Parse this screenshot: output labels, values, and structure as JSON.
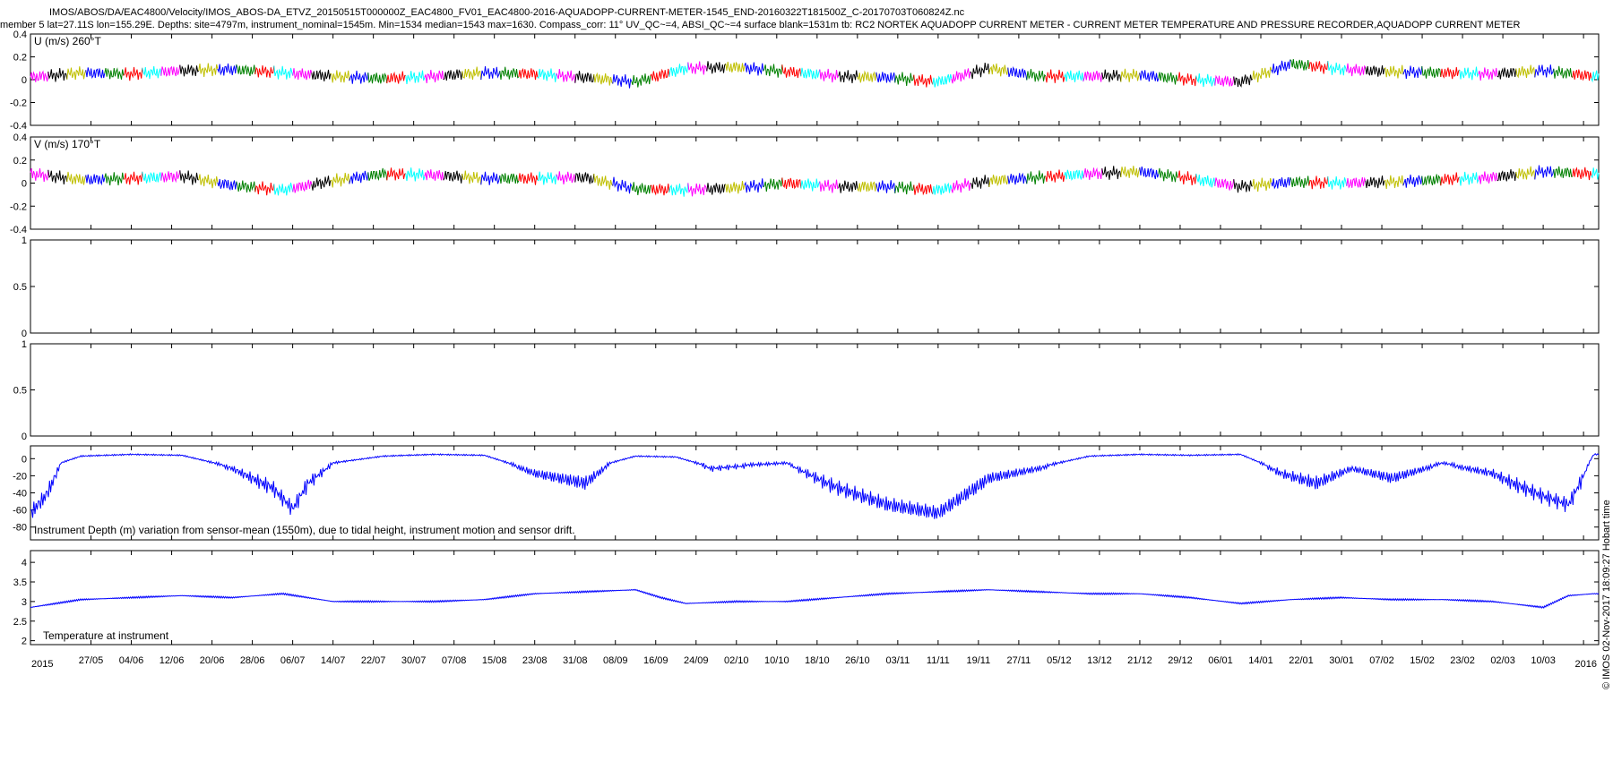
{
  "header": {
    "line1": "IMOS/ABOS/DA/EAC4800/Velocity/IMOS_ABOS-DA_ETVZ_20150515T000000Z_EAC4800_FV01_EAC4800-2016-AQUADOPP-CURRENT-METER-1545_END-20160322T181500Z_C-20170703T060824Z.nc",
    "line2": "member 5 lat=27.11S lon=155.29E. Depths: site=4797m, instrument_nominal=1545m. Min=1534 median=1543 max=1630. Compass_corr: 11° UV_QC~=4, ABSI_QC~=4 surface blank=1531m tb: RC2 NORTEK AQUADOPP CURRENT METER - CURRENT METER TEMPERATURE AND PRESSURE RECORDER,AQUADOPP CURRENT METER"
  },
  "watermark": "© IMOS 02-Nov-2017 18:09:27 Hobart time",
  "chart_data": [
    {
      "type": "line",
      "id": "u",
      "title": "U (m/s) 260°T",
      "ylim": [
        -0.4,
        0.4
      ],
      "yticks": [
        "0.4",
        "0.2",
        "0",
        "-0.2",
        "-0.4"
      ],
      "ytick_values": [
        0.4,
        0.2,
        0,
        -0.2,
        -0.4
      ],
      "series": [
        {
          "color": "multicolor",
          "x_days": [
            0,
            10,
            20,
            30,
            40,
            50,
            60,
            70,
            80,
            90,
            100,
            110,
            120,
            130,
            140,
            150,
            160,
            170,
            180,
            190,
            200,
            210,
            220,
            230,
            240,
            250,
            260,
            270,
            280,
            290,
            300,
            310
          ],
          "y_mean": [
            0.02,
            0.06,
            0.05,
            0.08,
            0.09,
            0.06,
            0.03,
            0.01,
            0.03,
            0.06,
            0.05,
            0.02,
            -0.02,
            0.1,
            0.11,
            0.07,
            0.03,
            0.02,
            -0.02,
            0.1,
            0.03,
            0.03,
            0.04,
            0.0,
            -0.02,
            0.14,
            0.09,
            0.07,
            0.06,
            0.05,
            0.08,
            0.03
          ]
        }
      ]
    },
    {
      "type": "line",
      "id": "v",
      "title": "V (m/s) 170°T",
      "ylim": [
        -0.4,
        0.4
      ],
      "yticks": [
        "0.4",
        "0.2",
        "0",
        "-0.2",
        "-0.4"
      ],
      "ytick_values": [
        0.4,
        0.2,
        0,
        -0.2,
        -0.4
      ],
      "series": [
        {
          "color": "multicolor",
          "x_days": [
            0,
            10,
            20,
            30,
            40,
            50,
            60,
            70,
            80,
            90,
            100,
            110,
            120,
            130,
            140,
            150,
            160,
            170,
            180,
            190,
            200,
            210,
            220,
            230,
            240,
            250,
            260,
            270,
            280,
            290,
            300,
            310
          ],
          "y_mean": [
            0.08,
            0.03,
            0.04,
            0.06,
            -0.02,
            -0.06,
            0.02,
            0.08,
            0.07,
            0.04,
            0.04,
            0.05,
            -0.05,
            -0.06,
            -0.04,
            0.0,
            -0.03,
            -0.03,
            -0.06,
            0.02,
            0.05,
            0.08,
            0.1,
            0.04,
            -0.03,
            0.01,
            0.0,
            0.01,
            0.03,
            0.05,
            0.1,
            0.08
          ]
        }
      ]
    },
    {
      "type": "line",
      "id": "empty1",
      "title": "",
      "ylim": [
        0,
        1
      ],
      "yticks": [
        "1",
        "0.5",
        "0"
      ],
      "ytick_values": [
        1,
        0.5,
        0
      ],
      "series": []
    },
    {
      "type": "line",
      "id": "empty2",
      "title": "",
      "ylim": [
        0,
        1
      ],
      "yticks": [
        "1",
        "0.5",
        "0"
      ],
      "ytick_values": [
        1,
        0.5,
        0
      ],
      "series": []
    },
    {
      "type": "line",
      "id": "depth",
      "title": "Instrument Depth (m) variation from sensor-mean (1550m), due to tidal height, instrument motion and sensor drift.",
      "ylim": [
        -95,
        15
      ],
      "yticks": [
        "0",
        "-20",
        "-40",
        "-60",
        "-80"
      ],
      "ytick_values": [
        0,
        -20,
        -40,
        -60,
        -80
      ],
      "series": [
        {
          "color": "#0000ff",
          "x_days": [
            0,
            3,
            6,
            10,
            20,
            30,
            40,
            48,
            52,
            55,
            60,
            70,
            80,
            90,
            100,
            110,
            115,
            120,
            128,
            135,
            140,
            150,
            160,
            170,
            180,
            190,
            200,
            210,
            220,
            230,
            240,
            248,
            255,
            262,
            270,
            280,
            290,
            300,
            305,
            310
          ],
          "y": [
            -60,
            -40,
            -5,
            3,
            5,
            4,
            -10,
            -30,
            -55,
            -25,
            -5,
            3,
            5,
            4,
            -15,
            -25,
            -5,
            3,
            2,
            -10,
            -8,
            -5,
            -30,
            -50,
            -60,
            -20,
            -10,
            3,
            5,
            4,
            5,
            -15,
            -25,
            -10,
            -20,
            -5,
            -15,
            -40,
            -50,
            5
          ]
        }
      ]
    },
    {
      "type": "line",
      "id": "temp",
      "title": "Temperature at instrument",
      "ylim": [
        1.9,
        4.3
      ],
      "yticks": [
        "4",
        "3.5",
        "3",
        "2.5",
        "2"
      ],
      "ytick_values": [
        4,
        3.5,
        3,
        2.5,
        2
      ],
      "series": [
        {
          "color": "#0000ff",
          "x_days": [
            0,
            5,
            10,
            20,
            30,
            40,
            50,
            60,
            70,
            80,
            90,
            100,
            110,
            120,
            125,
            130,
            140,
            150,
            160,
            170,
            180,
            190,
            200,
            210,
            220,
            230,
            240,
            250,
            260,
            270,
            280,
            290,
            300,
            305,
            310
          ],
          "y": [
            2.85,
            2.95,
            3.05,
            3.1,
            3.15,
            3.1,
            3.2,
            3.0,
            3.0,
            3.0,
            3.05,
            3.2,
            3.25,
            3.3,
            3.1,
            2.95,
            3.0,
            3.0,
            3.1,
            3.2,
            3.25,
            3.3,
            3.25,
            3.2,
            3.2,
            3.1,
            2.95,
            3.05,
            3.1,
            3.05,
            3.05,
            3.0,
            2.85,
            3.15,
            3.2
          ]
        }
      ]
    }
  ],
  "x_axis": {
    "start_label": "2015",
    "end_label": "2016",
    "tick_labels": [
      "27/05",
      "04/06",
      "12/06",
      "20/06",
      "28/06",
      "06/07",
      "14/07",
      "22/07",
      "30/07",
      "07/08",
      "15/08",
      "23/08",
      "31/08",
      "08/09",
      "16/09",
      "24/09",
      "02/10",
      "10/10",
      "18/10",
      "26/10",
      "03/11",
      "11/11",
      "19/11",
      "27/11",
      "05/12",
      "13/12",
      "21/12",
      "29/12",
      "06/01",
      "14/01",
      "22/01",
      "30/01",
      "07/02",
      "15/02",
      "23/02",
      "02/03",
      "10/03"
    ]
  },
  "colors": {
    "u_v_multicolor": [
      "#ff00ff",
      "#00ffff",
      "#ff0000",
      "#008000",
      "#0000ff",
      "#bfbf00",
      "#000000"
    ],
    "depth_temp": "#0000ff"
  }
}
